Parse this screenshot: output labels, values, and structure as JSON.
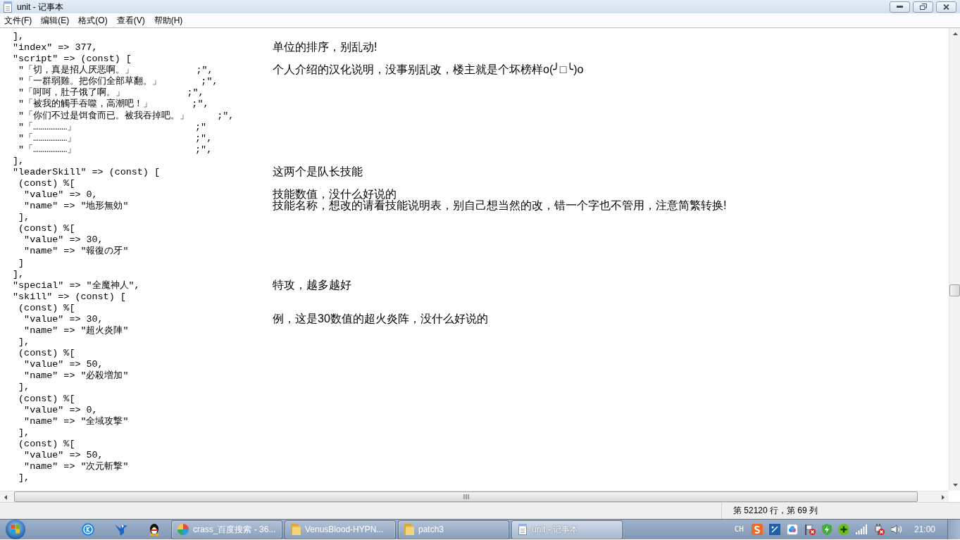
{
  "window": {
    "title": "unit - 记事本"
  },
  "menu": [
    "文件(F)",
    "编辑(E)",
    "格式(O)",
    "查看(V)",
    "帮助(H)"
  ],
  "editor": {
    "lines": [
      {
        "code": " ],"
      },
      {
        "code": " \"index\" => 377,",
        "note": "单位的排序，别乱动!"
      },
      {
        "code": " \"script\" => (const) ["
      },
      {
        "code": "  \"「切，真是招人厌恶啊。」           ;\",",
        "note": "个人介绍的汉化说明，没事别乱改，楼主就是个坏榜样o(╯□╰)o"
      },
      {
        "code": "  \"「一群弱雞。把你们全部草翻。」       ;\","
      },
      {
        "code": "  \"「呵呵，肚子饿了啊。」           ;\","
      },
      {
        "code": "  \"「被我的觸手吞噬，高潮吧！」       ;\","
      },
      {
        "code": "  \"「你们不过是饵食而已。被我吞掉吧。」     ;\","
      },
      {
        "code": "  \"「………………」                     ;\""
      },
      {
        "code": "  \"「………………」                     ;\","
      },
      {
        "code": "  \"「………………」                     ;\","
      },
      {
        "code": " ],"
      },
      {
        "code": " \"leaderSkill\" => (const) [",
        "note": "这两个是队长技能"
      },
      {
        "code": "  (const) %["
      },
      {
        "code": "   \"value\" => 0,",
        "note": "技能数值，没什么好说的"
      },
      {
        "code": "   \"name\" => \"地形無効\"",
        "note": "技能名称，想改的请看技能说明表，别自己想当然的改，错一个字也不管用，注意简繁转换!"
      },
      {
        "code": "  ],"
      },
      {
        "code": "  (const) %["
      },
      {
        "code": "   \"value\" => 30,"
      },
      {
        "code": "   \"name\" => \"報復の牙\""
      },
      {
        "code": "  ]"
      },
      {
        "code": " ],"
      },
      {
        "code": " \"special\" => \"全魔神人\",",
        "note": "特攻，越多越好"
      },
      {
        "code": " \"skill\" => (const) ["
      },
      {
        "code": "  (const) %["
      },
      {
        "code": "   \"value\" => 30,",
        "note": "例，这是30数值的超火炎阵，没什么好说的"
      },
      {
        "code": "   \"name\" => \"超火炎陣\""
      },
      {
        "code": "  ],"
      },
      {
        "code": "  (const) %["
      },
      {
        "code": "   \"value\" => 50,"
      },
      {
        "code": "   \"name\" => \"必殺増加\""
      },
      {
        "code": "  ],"
      },
      {
        "code": "  (const) %["
      },
      {
        "code": "   \"value\" => 0,"
      },
      {
        "code": "   \"name\" => \"全域攻撃\""
      },
      {
        "code": "  ],"
      },
      {
        "code": "  (const) %["
      },
      {
        "code": "   \"value\" => 50,"
      },
      {
        "code": "   \"name\" => \"次元斬撃\""
      },
      {
        "code": "  ],"
      }
    ]
  },
  "status_bar": {
    "position": "第 52120 行，第 69 列"
  },
  "taskbar": {
    "tasks": [
      {
        "kind": "browser",
        "label": "crass_百度搜索 - 36...",
        "selected": false
      },
      {
        "kind": "folder",
        "label": "VenusBlood-HYPN...",
        "selected": false
      },
      {
        "kind": "folder",
        "label": "patch3",
        "selected": false
      },
      {
        "kind": "notepad",
        "label": "unit - 记事本",
        "selected": true
      }
    ],
    "tray": {
      "language": "CH",
      "clock": "21:00"
    }
  }
}
